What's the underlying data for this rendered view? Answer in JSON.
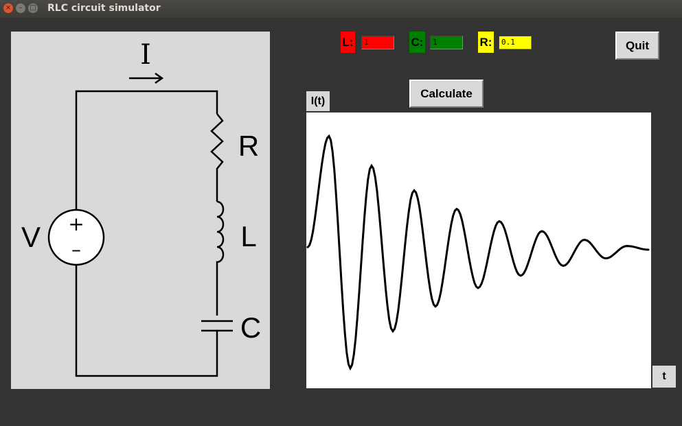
{
  "window": {
    "title": "RLC circuit simulator",
    "close_glyph": "×",
    "minimize_glyph": "–",
    "maximize_glyph": "□"
  },
  "circuit": {
    "current_label": "I",
    "voltage_label": "V",
    "resistor_label": "R",
    "inductor_label": "L",
    "capacitor_label": "C",
    "plus_sign": "+",
    "minus_sign": "–"
  },
  "inputs": {
    "L": {
      "label": "L:",
      "value": "1",
      "color": "#ff0000"
    },
    "C": {
      "label": "C:",
      "value": "1",
      "color": "#008000"
    },
    "R": {
      "label": "R:",
      "value": "0.1",
      "color": "#ffff00"
    }
  },
  "buttons": {
    "quit": "Quit",
    "calculate": "Calculate"
  },
  "plot": {
    "y_label": "I(t)",
    "x_label": "t"
  },
  "chart_data": {
    "type": "line",
    "title": "",
    "xlabel": "t",
    "ylabel": "I(t)",
    "description_of_curve": "damped sinusoid",
    "series": [
      {
        "x": [
          0,
          1,
          2,
          3,
          4,
          5,
          6,
          7,
          8,
          9,
          10,
          11,
          12,
          13,
          14,
          15,
          16
        ],
        "values": [
          0.02,
          0.92,
          -0.96,
          0.68,
          -0.66,
          0.48,
          -0.46,
          0.33,
          -0.31,
          0.23,
          -0.21,
          0.15,
          -0.13,
          0.08,
          -0.07,
          0.03,
          0.0
        ]
      }
    ],
    "damping": 0.05,
    "frequency": 1.0,
    "grid": false,
    "legend": "none"
  }
}
